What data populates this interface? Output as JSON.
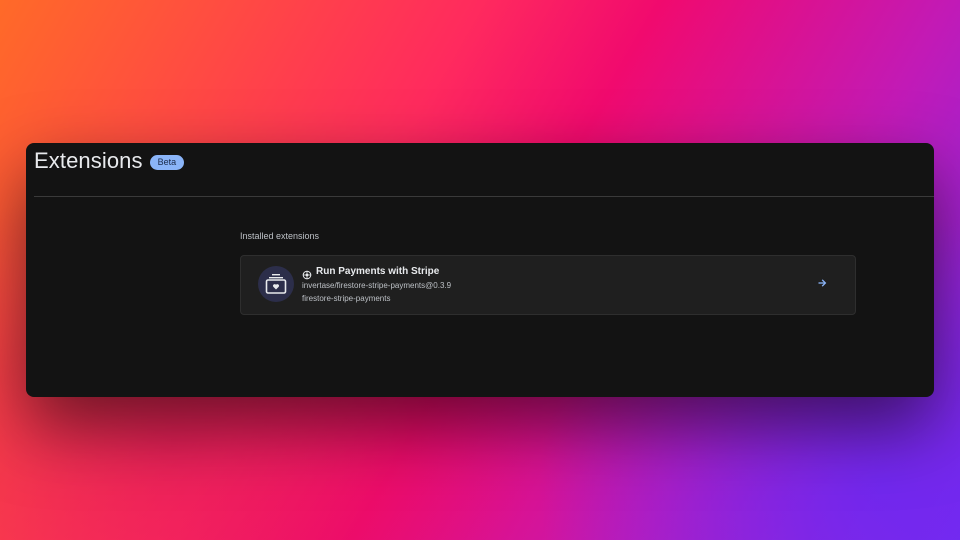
{
  "header": {
    "title": "Extensions",
    "badge": "Beta"
  },
  "main": {
    "section_label": "Installed extensions",
    "extensions": [
      {
        "name": "Run Payments with Stripe",
        "publisher_ref": "invertase/firestore-stripe-payments@0.3.9",
        "instance_id": "firestore-stripe-payments",
        "icon": "stripe-payments-icon",
        "action_icon": "arrow-right-icon"
      }
    ]
  },
  "colors": {
    "accent": "#8ab4f8",
    "window_bg": "#131313",
    "card_bg": "#1f1f1f",
    "icon_bg": "#2c2e4a"
  }
}
